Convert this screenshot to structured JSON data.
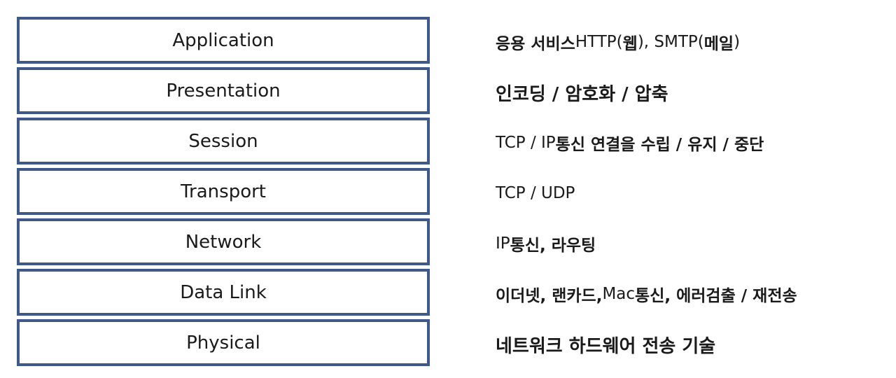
{
  "layers": [
    {
      "name": "Application"
    },
    {
      "name": "Presentation"
    },
    {
      "name": "Session"
    },
    {
      "name": "Transport"
    },
    {
      "name": "Network"
    },
    {
      "name": "Data Link"
    },
    {
      "name": "Physical"
    }
  ],
  "descriptions": [
    {
      "bold1": "응용 서비스",
      "normal1": " HTTP(",
      "bold2": "웹",
      "normal2": "), SMTP(",
      "bold3": "메일",
      "normal3": ")"
    },
    {
      "text": "인코딩 / 암호화 /  압축"
    },
    {
      "normal1": "TCP / IP ",
      "bold1": "통신 연결을 수립 / 유지 / 중단"
    },
    {
      "text": "TCP / UDP"
    },
    {
      "normal1": "IP ",
      "bold1": "통신, 라우팅"
    },
    {
      "bold1": "이더넷, 랜카드,",
      "normal1": " Mac ",
      "bold2": "통신, 에러검출 / 재전송"
    },
    {
      "text": "네트워크 하드웨어 전송 기술"
    }
  ],
  "colors": {
    "box_border": "#3f5a8a",
    "text": "#1a1a1a",
    "background": "#ffffff"
  }
}
